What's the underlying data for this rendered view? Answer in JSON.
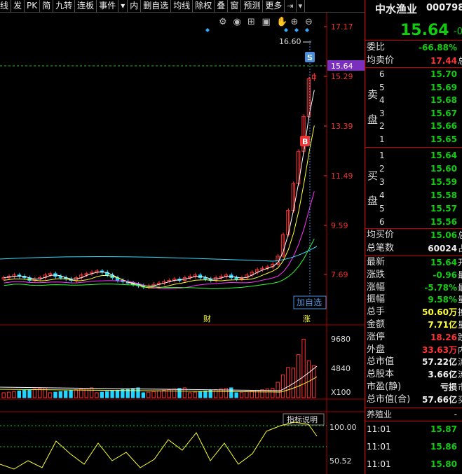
{
  "toolbar": {
    "buttons": [
      "线",
      "发",
      "PK",
      "简",
      "九转",
      "连板",
      "事件",
      "▾",
      "内",
      "删自选",
      "均线",
      "除权",
      "叠",
      "窗",
      "预测",
      "更多"
    ],
    "icons": [
      "export-icon",
      "dropdown-icon"
    ]
  },
  "chart_tools": [
    "gear-icon",
    "eye-icon",
    "basket-icon",
    "camera-icon",
    "hand-icon",
    "zoom-in-icon",
    "zoom-out-icon"
  ],
  "price_axis": {
    "ticks": [
      "17.17",
      "15.29",
      "13.39",
      "11.49",
      "9.59",
      "7.69"
    ],
    "current_price_badge": "15.64",
    "high_label": "16.60"
  },
  "markers": {
    "sell": "S",
    "buy": "B",
    "add_watchlist": "加自选"
  },
  "event_labels": [
    "财",
    "涨"
  ],
  "volume_axis": {
    "ticks": [
      "9680",
      "4840",
      "X100"
    ]
  },
  "indicator": {
    "button_label": "指标说明",
    "ticks": [
      "100.00",
      "50.52"
    ]
  },
  "colors": {
    "up": "#ff3333",
    "down": "#1ccc1c",
    "accent": "#00bfff",
    "badge": "#7b2fbf"
  },
  "chart_data": {
    "type": "candlestick",
    "ylim": [
      6.5,
      17.6
    ],
    "close_series": [
      8.1,
      8.15,
      8.2,
      8.15,
      8.1,
      8.0,
      8.05,
      8.1,
      8.2,
      8.25,
      8.15,
      8.1,
      8.05,
      8.0,
      8.1,
      8.2,
      8.25,
      8.3,
      8.35,
      8.3,
      8.2,
      8.1,
      8.0,
      7.95,
      7.9,
      7.85,
      7.8,
      7.75,
      7.8,
      7.85,
      7.9,
      7.95,
      8.0,
      8.05,
      8.0,
      8.1,
      8.15,
      8.2,
      8.1,
      8.05,
      8.0,
      8.1,
      8.15,
      8.2,
      8.1,
      8.05,
      8.1,
      8.2,
      8.3,
      8.4,
      8.45,
      8.5,
      8.6,
      8.9,
      9.7,
      10.6,
      11.6,
      12.8,
      14.1,
      15.5,
      15.64
    ]
  },
  "stock": {
    "name": "中水渔业",
    "code": "000798",
    "price": "15.64",
    "change_pct_partial": "-0"
  },
  "summary": [
    {
      "label": "委比",
      "value": "-66.88%",
      "color": "green",
      "extra": ""
    },
    {
      "label": "均卖价",
      "value": "17.44",
      "color": "red",
      "extra": "总"
    }
  ],
  "sell_side_label": [
    "卖",
    "盘"
  ],
  "sell_orders": [
    {
      "idx": "6",
      "price": "15.70"
    },
    {
      "idx": "5",
      "price": "15.69"
    },
    {
      "idx": "4",
      "price": "15.68"
    },
    {
      "idx": "3",
      "price": "15.67"
    },
    {
      "idx": "2",
      "price": "15.66"
    },
    {
      "idx": "1",
      "price": "15.65"
    }
  ],
  "buy_side_label": [
    "买",
    "盘"
  ],
  "buy_orders": [
    {
      "idx": "1",
      "price": "15.64"
    },
    {
      "idx": "2",
      "price": "15.60"
    },
    {
      "idx": "3",
      "price": "15.59"
    },
    {
      "idx": "4",
      "price": "15.58"
    },
    {
      "idx": "5",
      "price": "15.57"
    },
    {
      "idx": "6",
      "price": "15.56"
    }
  ],
  "avg_buy": {
    "label": "均买价",
    "value": "15.06",
    "extra": "总"
  },
  "total_trades": {
    "label": "总笔数",
    "value": "60024",
    "extra": "占"
  },
  "stats": [
    {
      "label": "最新",
      "value": "15.64",
      "color": "green",
      "extra": "开"
    },
    {
      "label": "涨跌",
      "value": "-0.96",
      "color": "green",
      "extra": "最"
    },
    {
      "label": "涨幅",
      "value": "-5.78%",
      "color": "green",
      "extra": "最"
    },
    {
      "label": "振幅",
      "value": "9.58%",
      "color": "green",
      "extra": "量"
    },
    {
      "label": "总手",
      "value": "50.60万",
      "color": "yellow",
      "extra": "换"
    },
    {
      "label": "金额",
      "value": "7.71亿",
      "color": "yellow",
      "extra": "量"
    },
    {
      "label": "涨停",
      "value": "18.26",
      "color": "red",
      "extra": "跌"
    },
    {
      "label": "外盘",
      "value": "33.63万",
      "color": "red",
      "extra": "内"
    },
    {
      "label": "总市值",
      "value": "57.22亿",
      "color": "white",
      "extra": "流"
    },
    {
      "label": "总股本",
      "value": "3.66亿",
      "color": "white",
      "extra": "流"
    },
    {
      "label": "市盈(静)",
      "value": "亏损",
      "color": "white",
      "extra": "市"
    },
    {
      "label": "总市值(合)",
      "value": "57.66亿",
      "color": "white",
      "extra": "买"
    }
  ],
  "industry": {
    "label": "养殖业",
    "value": "-"
  },
  "ticks": [
    {
      "time": "11:01",
      "price": "15.87"
    },
    {
      "time": "11:01",
      "price": "15.86"
    },
    {
      "time": "11:01",
      "price": "15.80"
    }
  ]
}
